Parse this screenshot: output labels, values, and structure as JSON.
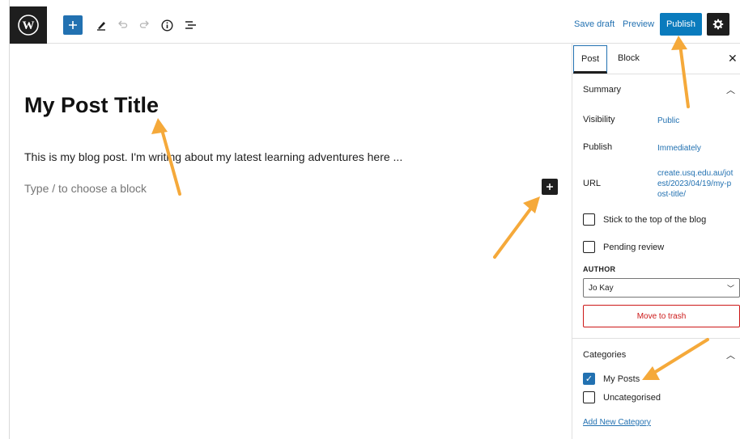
{
  "topbar": {
    "save_draft": "Save draft",
    "preview": "Preview",
    "publish": "Publish",
    "icons": [
      "wordpress-logo",
      "add-block-icon",
      "pencil-icon",
      "undo-icon",
      "redo-icon",
      "info-icon",
      "list-view-icon",
      "gear-icon"
    ]
  },
  "editor": {
    "title": "My Post Title",
    "body": "This is my blog post. I'm writing about my latest learning adventures here ...",
    "placeholder": "Type / to choose a block"
  },
  "sidebar": {
    "tabs": [
      "Post",
      "Block"
    ],
    "summary": {
      "heading": "Summary",
      "visibility_label": "Visibility",
      "visibility_value": "Public",
      "publish_label": "Publish",
      "publish_value": "Immediately",
      "url_label": "URL",
      "url_value": "create.usq.edu.au/jotest/2023/04/19/my-post-title/",
      "stick_top": "Stick to the top of the blog",
      "pending_review": "Pending review",
      "author_label": "AUTHOR",
      "author_value": "Jo Kay",
      "trash": "Move to trash"
    },
    "categories": {
      "heading": "Categories",
      "items": [
        {
          "label": "My Posts",
          "checked": true
        },
        {
          "label": "Uncategorised",
          "checked": false
        }
      ],
      "add_new": "Add New Category"
    }
  },
  "colors": {
    "accent": "#2271b1",
    "publish": "#0a7bbd",
    "dark": "#1e1e1e",
    "danger": "#cc1818",
    "annotation": "#f5a93a"
  }
}
